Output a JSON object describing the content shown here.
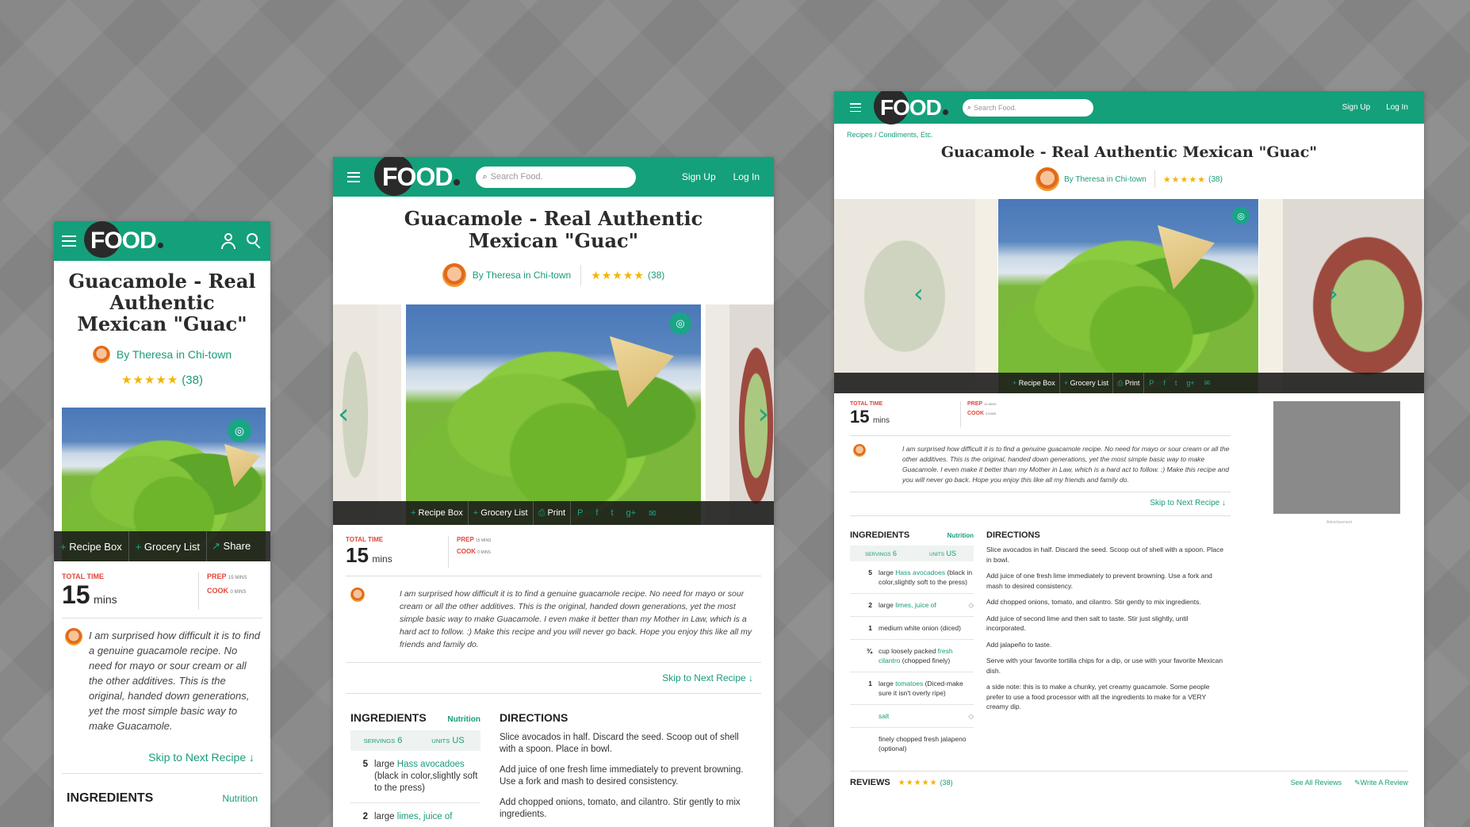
{
  "brand": {
    "name": "FOOD",
    "accent": "#14a07a",
    "star_color": "#f4b400",
    "red": "#e0463b"
  },
  "header": {
    "search_placeholder": "Search Food.",
    "sign_up": "Sign Up",
    "log_in": "Log In"
  },
  "breadcrumb": "Recipes / Condiments, Etc.",
  "recipe": {
    "title": "Guacamole - Real Authentic Mexican \"Guac\"",
    "author": "By Theresa in Chi-town",
    "rating_stars": "★★★★★",
    "rating_count": "(38)",
    "actions": {
      "recipe_box": "Recipe Box",
      "grocery_list": "Grocery List",
      "print": "Print",
      "share": "Share"
    },
    "total_time_label": "TOTAL TIME",
    "total_time_value": "15",
    "mins": "mins",
    "prep_label": "PREP",
    "prep_value": "15 MINS",
    "cook_label": "COOK",
    "cook_value": "0 MINS",
    "description": "I am surprised how difficult it is to find a genuine guacamole recipe. No need for mayo or sour cream or all the other additives. This is the original, handed down generations, yet the most simple basic way to make Guacamole. I even make it better than my Mother in Law, which is a hard act to follow. :) Make this recipe and you will never go back. Hope you enjoy this like all my friends and family do.",
    "description_mobile": "I am surprised how difficult it is to find a genuine guacamole recipe. No need for mayo or sour cream or all the other additives. This is the original, handed down generations, yet the most simple basic way to make Guacamole.",
    "skip": "Skip to Next Recipe ↓",
    "ingredients_heading": "INGREDIENTS",
    "nutrition": "Nutrition",
    "servings_label": "SERVINGS",
    "servings_value": "6",
    "units_label": "UNITS",
    "units_value": "US",
    "ingredients": [
      {
        "qty": "5",
        "pre": "large ",
        "link": "Hass avocadoes",
        "post": " (black in color,slightly soft to the press)"
      },
      {
        "qty": "2",
        "pre": "large ",
        "link": "limes, juice of",
        "post": ""
      },
      {
        "qty": "1",
        "pre": "medium white onion (diced)",
        "link": "",
        "post": ""
      },
      {
        "qty": "¾",
        "pre": "cup loosely packed ",
        "link": "fresh cilantro",
        "post": " (chopped finely)"
      },
      {
        "qty": "1",
        "pre": "large ",
        "link": "tomatoes",
        "post": " (Diced-make sure it isn't overly ripe)"
      },
      {
        "qty": "",
        "pre": "",
        "link": "salt",
        "post": ""
      },
      {
        "qty": "",
        "pre": "finely chopped fresh jalapeno (optional)",
        "link": "",
        "post": ""
      }
    ],
    "directions_heading": "DIRECTIONS",
    "directions": [
      "Slice avocados in half. Discard the seed. Scoop out of shell with a spoon. Place in bowl.",
      "Add juice of one fresh lime immediately to prevent browning. Use a fork and mash to desired consistency.",
      "Add chopped onions, tomato, and cilantro. Stir gently to mix ingredients.",
      "Add juice of second lime and then salt to taste. Stir just slightly, until incorporated.",
      "Add jalapeño to taste.",
      "Serve with your favorite tortilla chips for a dip, or use with your favorite Mexican dish.",
      "a side note: this is to make a chunky, yet creamy guacamole. Some people prefer to use a food processor with all the ingredients to make for a VERY creamy dip."
    ],
    "reviews_heading": "REVIEWS",
    "see_all_reviews": "See All Reviews",
    "write_review": "Write A Review",
    "advertisement": "Advertisement"
  }
}
